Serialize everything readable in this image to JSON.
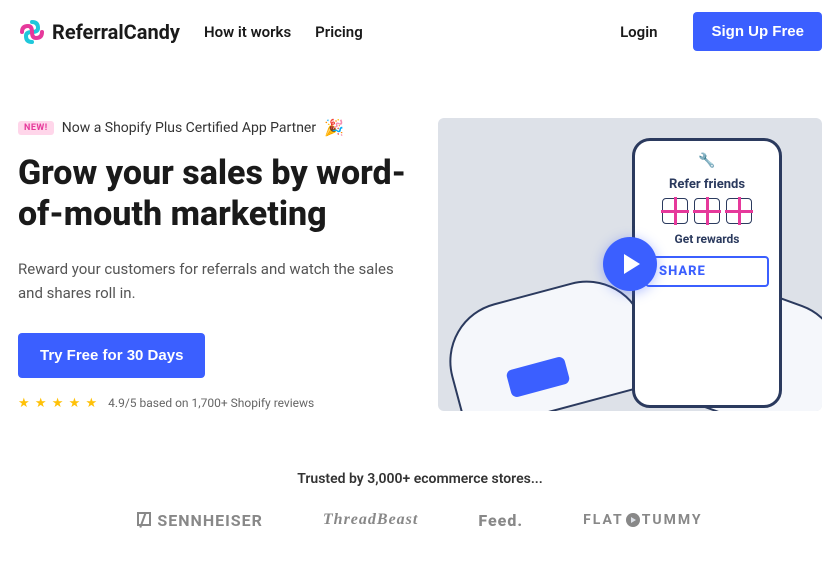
{
  "header": {
    "brand": "ReferralCandy",
    "nav": {
      "how": "How it works",
      "pricing": "Pricing"
    },
    "login": "Login",
    "signup": "Sign Up Free"
  },
  "hero": {
    "badge": "NEW!",
    "partner": "Now a Shopify Plus Certified App Partner",
    "party_emoji": "🎉",
    "headline": "Grow your sales by word-of-mouth marketing",
    "subhead": "Reward your customers for referrals and watch the sales and shares roll in.",
    "cta": "Try Free for 30 Days",
    "rating_text": "4.9/5 based on 1,700+ Shopify reviews",
    "phone": {
      "title": "Refer friends",
      "rewards": "Get rewards",
      "share": "SHARE"
    }
  },
  "trusted": {
    "line": "Trusted by 3,000+ ecommerce stores...",
    "brands": {
      "sennheiser": "SENNHEISER",
      "threadbeast": "ThreadBeast",
      "feed": "Feed.",
      "flat": "FLAT",
      "tummy": "TUMMY"
    }
  }
}
